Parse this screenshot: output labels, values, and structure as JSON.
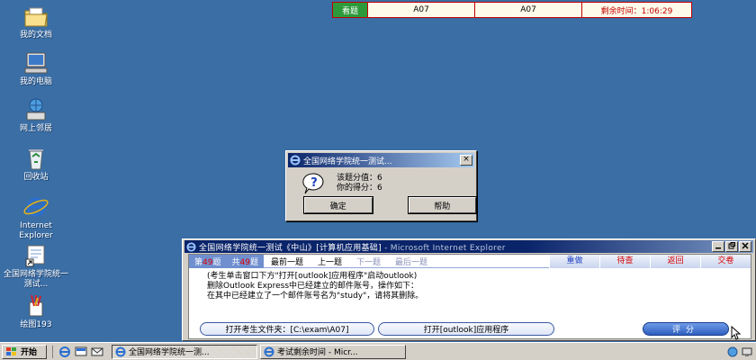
{
  "desktop": {
    "icons": [
      {
        "label": "我的文档",
        "icon": "folder-documents-icon"
      },
      {
        "label": "我的电脑",
        "icon": "computer-icon"
      },
      {
        "label": "网上邻居",
        "icon": "network-icon"
      },
      {
        "label": "回收站",
        "icon": "recycle-bin-icon"
      },
      {
        "label": "Internet Explorer",
        "icon": "internet-explorer-icon"
      },
      {
        "label": "全国网络学院统一测试...",
        "icon": "shortcut-icon"
      },
      {
        "label": "绘图193",
        "icon": "paint-icon"
      }
    ]
  },
  "timer": {
    "view_label": "看题",
    "question_a": "A07",
    "question_b": "A07",
    "remaining": "剩余时间：1:06:29"
  },
  "msgbox": {
    "title": "全国网络学院统一测试...",
    "close": "×",
    "line1": "该题分值：6",
    "line2": "你的得分：6",
    "ok_label": "确定",
    "help_label": "帮助"
  },
  "exam_window": {
    "title_main": "全国网络学院统一测试《中山》[计算机应用基础]",
    "title_app": " - Microsoft Internet Explorer",
    "nav": {
      "current_prefix": "第",
      "current_num": "49",
      "current_suffix": "题",
      "total_prefix": "共",
      "total_num": "49",
      "total_suffix": "题",
      "first": "最前一题",
      "prev": "上一题",
      "next": "下一题",
      "last": "最后一题",
      "redo": "重做",
      "pending": "待查",
      "back": "返回",
      "submit": "交卷"
    },
    "task_lines": [
      "(考生单击窗口下方\"打开[outlook]应用程序\"启动outlook)",
      "删除Outlook Express中已经建立的邮件账号，操作如下：",
      "在其中已经建立了一个邮件账号名为\"study\"，请将其删除。"
    ],
    "open_folder": "打开考生文件夹：[C:\\exam\\A07]",
    "open_app": "打开[outlook]应用程序",
    "grade": "评分"
  },
  "taskbar": {
    "start": "开始",
    "tasks": [
      {
        "label": "全国网络学院统一测...",
        "active": true
      },
      {
        "label": "考试剩余时间 - Micr...",
        "active": false
      }
    ]
  },
  "colors": {
    "desktop": "#3a6ea5",
    "title_active": "#0a246a",
    "timer_border": "#c00000",
    "nav_blue": "#6f8fcf"
  }
}
